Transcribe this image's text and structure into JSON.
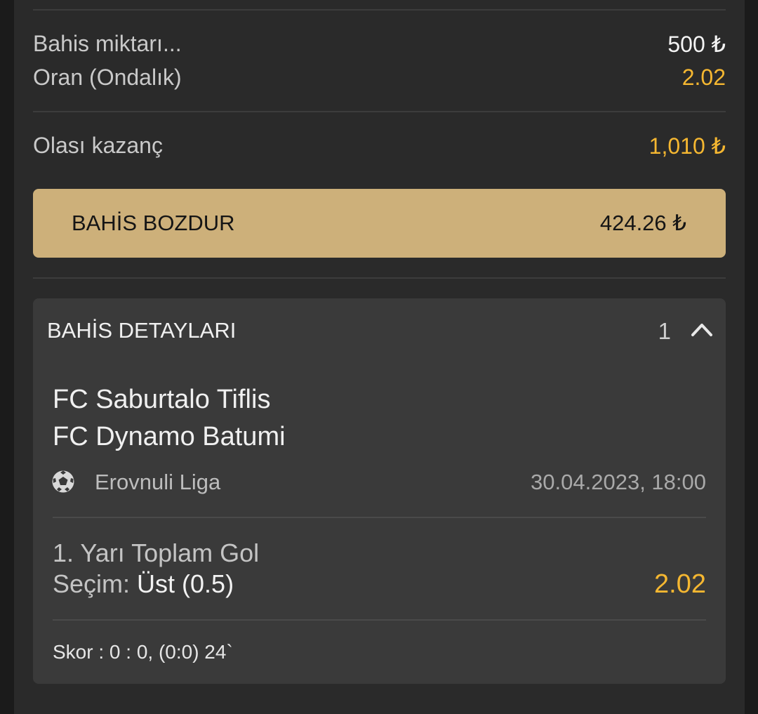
{
  "summary": {
    "stake_label": "Bahis miktarı...",
    "stake_value": "500 ₺",
    "odds_label": "Oran (Ondalık)",
    "odds_value": "2.02",
    "winnings_label": "Olası kazanç",
    "winnings_value": "1,010 ₺"
  },
  "cashout": {
    "label": "BAHİS BOZDUR",
    "value": "424.26 ₺"
  },
  "details": {
    "title": "BAHİS DETAYLARI",
    "count": "1",
    "home_team": "FC Saburtalo Tiflis",
    "away_team": "FC Dynamo Batumi",
    "league": "Erovnuli Liga",
    "sport_icon": "soccer-ball-icon",
    "datetime": "30.04.2023, 18:00",
    "market": "1. Yarı Toplam Gol",
    "selection_label": "Seçim:",
    "selection_value": "Üst (0.5)",
    "selection_odds": "2.02",
    "score": "Skor : 0 : 0, (0:0) 24`"
  },
  "colors": {
    "accent_gold": "#f5b731",
    "cashout_bg": "#cdb07a",
    "panel_bg": "#2a2a2a"
  }
}
